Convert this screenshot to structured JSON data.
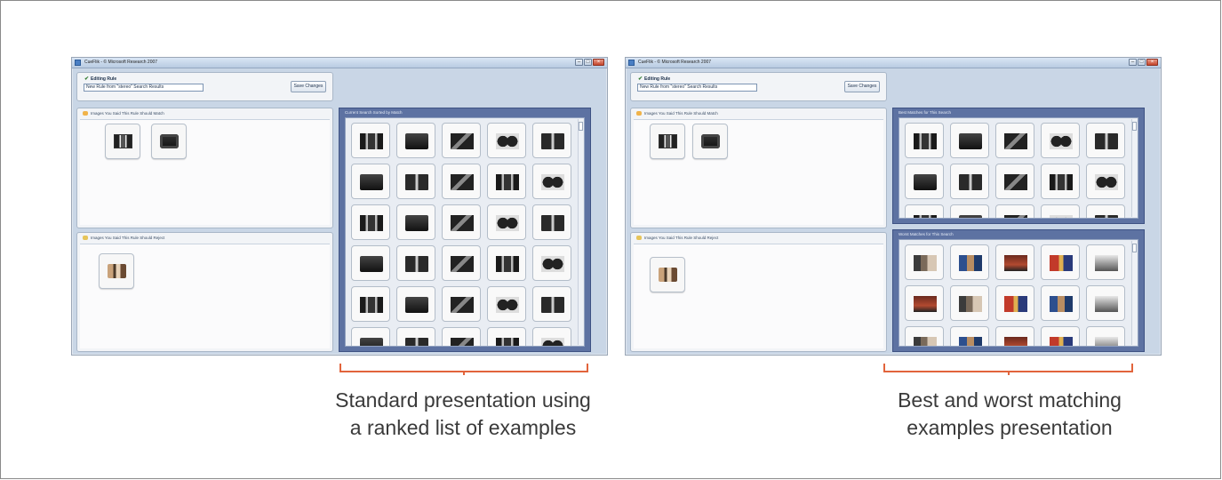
{
  "window": {
    "title": "CueFlik - © Microsoft Research 2007",
    "controls": [
      "–",
      "□",
      "×"
    ]
  },
  "rule_editor": {
    "label": "Editing Rule",
    "rule_name": "New Rule from \"stereo\" Search Results",
    "save_label": "Save Changes"
  },
  "sections": {
    "match_header": "Images You Said This Rule Should Match",
    "reject_header": "Images You Said This Rule Should Reject"
  },
  "results": {
    "standard_header": "Current Search Sorted by Match",
    "best_header": "Best Matches for This Search",
    "worst_header": "Worst Matches for This Search"
  },
  "captions": {
    "standard_line1": "Standard presentation using",
    "standard_line2": "a ranked list of examples",
    "best_worst_line1": "Best and worst matching",
    "best_worst_line2": "examples presentation"
  },
  "colors": {
    "bracket": "#e2643c",
    "results_panel": "#5d72a2"
  }
}
